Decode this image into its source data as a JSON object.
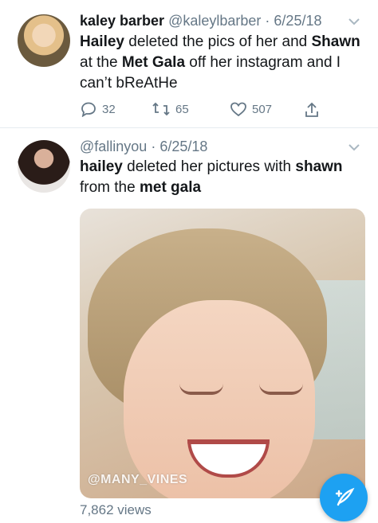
{
  "tweet1": {
    "name": "kaley barber",
    "handle": "@kaleylbarber",
    "date": "6/25/18",
    "text_parts": [
      "Hailey",
      " deleted the pics of her and ",
      "Shawn",
      " at the ",
      "Met Gala",
      " off her instagram and I can’t bReAtHe"
    ],
    "reply_count": "32",
    "retweet_count": "65",
    "like_count": "507"
  },
  "tweet2": {
    "handle": "@fallinyou",
    "date": "6/25/18",
    "text_parts": [
      "hailey",
      " deleted her pictures with ",
      "shawn",
      " from the ",
      "met gala"
    ],
    "watermark": "@MANY_VINES",
    "views": "7,862 views"
  },
  "separator": " · ",
  "colors": {
    "accent": "#1da1f2",
    "muted": "#657786",
    "text": "#14171a"
  },
  "icons": [
    "reply-icon",
    "retweet-icon",
    "heart-icon",
    "share-icon",
    "chevron-down-icon",
    "compose-icon"
  ]
}
